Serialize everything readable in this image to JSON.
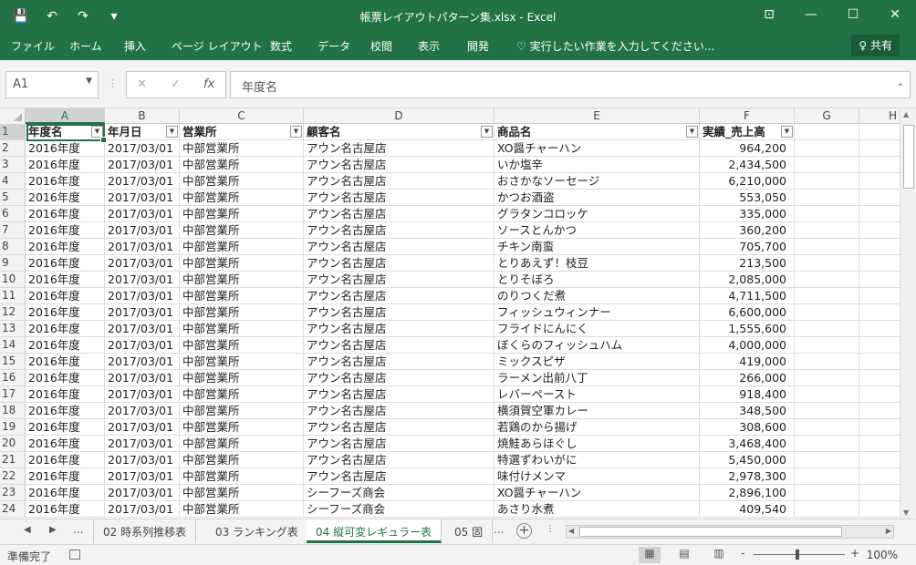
{
  "window": {
    "title": "帳票レイアウトパターン集.xlsx - Excel",
    "qat": {
      "save_icon": "💾",
      "undo_icon": "↶",
      "redo_icon": "↷",
      "customize_icon": "▾"
    },
    "buttons": {
      "ribbon_display": "⊡",
      "minimize": "—",
      "maximize": "☐",
      "close": "✕"
    }
  },
  "ribbon": {
    "tabs": [
      "ファイル",
      "ホーム",
      "挿入",
      "ページ レイアウト",
      "数式",
      "データ",
      "校閲",
      "表示",
      "開発"
    ],
    "tell_me": "♡ 実行したい作業を入力してください...",
    "share": "♀ 共有"
  },
  "formula_bar": {
    "name_box": "A1",
    "cancel_icon": "✕",
    "enter_icon": "✓",
    "fx_icon": "fx",
    "value": "年度名"
  },
  "columns": [
    "A",
    "B",
    "C",
    "D",
    "E",
    "F",
    "G",
    "H"
  ],
  "table": {
    "headers": [
      "年度名",
      "年月日",
      "営業所",
      "顧客名",
      "商品名",
      "実績_売上高"
    ],
    "rows": [
      [
        "2016年度",
        "2017/03/01",
        "中部営業所",
        "アウン名古屋店",
        "XO醤チャーハン",
        "964,200"
      ],
      [
        "2016年度",
        "2017/03/01",
        "中部営業所",
        "アウン名古屋店",
        "いか塩辛",
        "2,434,500"
      ],
      [
        "2016年度",
        "2017/03/01",
        "中部営業所",
        "アウン名古屋店",
        "おさかなソーセージ",
        "6,210,000"
      ],
      [
        "2016年度",
        "2017/03/01",
        "中部営業所",
        "アウン名古屋店",
        "かつお酒盗",
        "553,050"
      ],
      [
        "2016年度",
        "2017/03/01",
        "中部営業所",
        "アウン名古屋店",
        "グラタンコロッケ",
        "335,000"
      ],
      [
        "2016年度",
        "2017/03/01",
        "中部営業所",
        "アウン名古屋店",
        "ソースとんかつ",
        "360,200"
      ],
      [
        "2016年度",
        "2017/03/01",
        "中部営業所",
        "アウン名古屋店",
        "チキン南蛮",
        "705,700"
      ],
      [
        "2016年度",
        "2017/03/01",
        "中部営業所",
        "アウン名古屋店",
        "とりあえず！枝豆",
        "213,500"
      ],
      [
        "2016年度",
        "2017/03/01",
        "中部営業所",
        "アウン名古屋店",
        "とりそぼろ",
        "2,085,000"
      ],
      [
        "2016年度",
        "2017/03/01",
        "中部営業所",
        "アウン名古屋店",
        "のりつくだ煮",
        "4,711,500"
      ],
      [
        "2016年度",
        "2017/03/01",
        "中部営業所",
        "アウン名古屋店",
        "フィッシュウィンナー",
        "6,600,000"
      ],
      [
        "2016年度",
        "2017/03/01",
        "中部営業所",
        "アウン名古屋店",
        "フライドにんにく",
        "1,555,600"
      ],
      [
        "2016年度",
        "2017/03/01",
        "中部営業所",
        "アウン名古屋店",
        "ぼくらのフィッシュハム",
        "4,000,000"
      ],
      [
        "2016年度",
        "2017/03/01",
        "中部営業所",
        "アウン名古屋店",
        "ミックスピザ",
        "419,000"
      ],
      [
        "2016年度",
        "2017/03/01",
        "中部営業所",
        "アウン名古屋店",
        "ラーメン出前八丁",
        "266,000"
      ],
      [
        "2016年度",
        "2017/03/01",
        "中部営業所",
        "アウン名古屋店",
        "レバーペースト",
        "918,400"
      ],
      [
        "2016年度",
        "2017/03/01",
        "中部営業所",
        "アウン名古屋店",
        "横須賀空軍カレー",
        "348,500"
      ],
      [
        "2016年度",
        "2017/03/01",
        "中部営業所",
        "アウン名古屋店",
        "若鶏のから揚げ",
        "308,600"
      ],
      [
        "2016年度",
        "2017/03/01",
        "中部営業所",
        "アウン名古屋店",
        "焼鮭あらほぐし",
        "3,468,400"
      ],
      [
        "2016年度",
        "2017/03/01",
        "中部営業所",
        "アウン名古屋店",
        "特選ずわいがに",
        "5,450,000"
      ],
      [
        "2016年度",
        "2017/03/01",
        "中部営業所",
        "アウン名古屋店",
        "味付けメンマ",
        "2,978,300"
      ],
      [
        "2016年度",
        "2017/03/01",
        "中部営業所",
        "シーフーズ商会",
        "XO醤チャーハン",
        "2,896,100"
      ],
      [
        "2016年度",
        "2017/03/01",
        "中部営業所",
        "シーフーズ商会",
        "あさり水煮",
        "409,540"
      ]
    ]
  },
  "sheet_tabs": {
    "nav_prev": "◀",
    "nav_next": "▶",
    "more": "...",
    "tabs": [
      "02 時系列推移表",
      "03 ランキング表",
      "04 縦可変レギュラー表",
      "05 固"
    ],
    "more_right": "...",
    "add": "+"
  },
  "status_bar": {
    "text": "準備完了",
    "views": [
      "▦",
      "▤",
      "▥"
    ],
    "zoom_minus": "-",
    "zoom_plus": "+",
    "zoom": "100%"
  }
}
